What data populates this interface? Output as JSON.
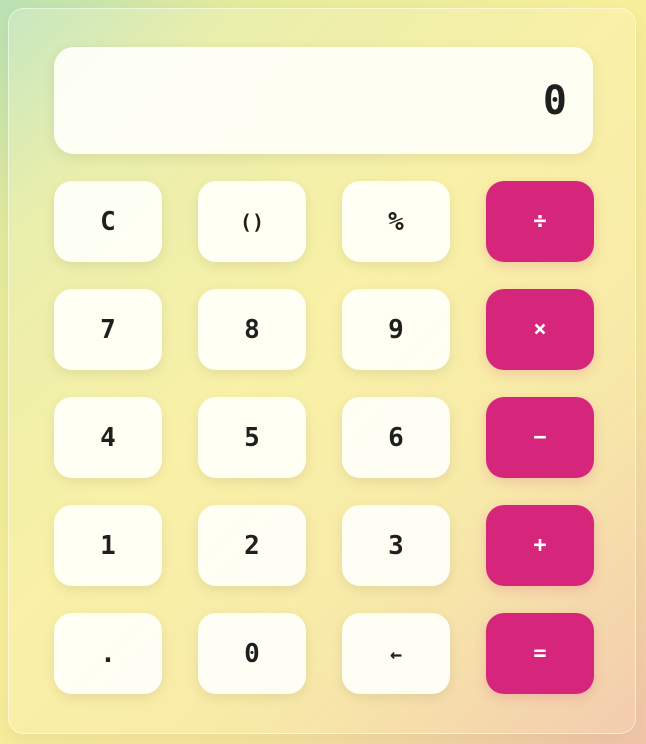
{
  "display": {
    "value": "0"
  },
  "keys": [
    {
      "label": "C",
      "type": "function"
    },
    {
      "label": "()",
      "type": "function"
    },
    {
      "label": "%",
      "type": "function"
    },
    {
      "label": "÷",
      "type": "operator"
    },
    {
      "label": "7",
      "type": "digit"
    },
    {
      "label": "8",
      "type": "digit"
    },
    {
      "label": "9",
      "type": "digit"
    },
    {
      "label": "×",
      "type": "operator"
    },
    {
      "label": "4",
      "type": "digit"
    },
    {
      "label": "5",
      "type": "digit"
    },
    {
      "label": "6",
      "type": "digit"
    },
    {
      "label": "−",
      "type": "operator"
    },
    {
      "label": "1",
      "type": "digit"
    },
    {
      "label": "2",
      "type": "digit"
    },
    {
      "label": "3",
      "type": "digit"
    },
    {
      "label": "+",
      "type": "operator"
    },
    {
      "label": ".",
      "type": "digit"
    },
    {
      "label": "0",
      "type": "digit"
    },
    {
      "label": "←",
      "type": "function"
    },
    {
      "label": "=",
      "type": "operator"
    }
  ],
  "colors": {
    "operator_key": "#d6267b",
    "standard_key": "#fffff8",
    "text": "#1f1f1f"
  }
}
